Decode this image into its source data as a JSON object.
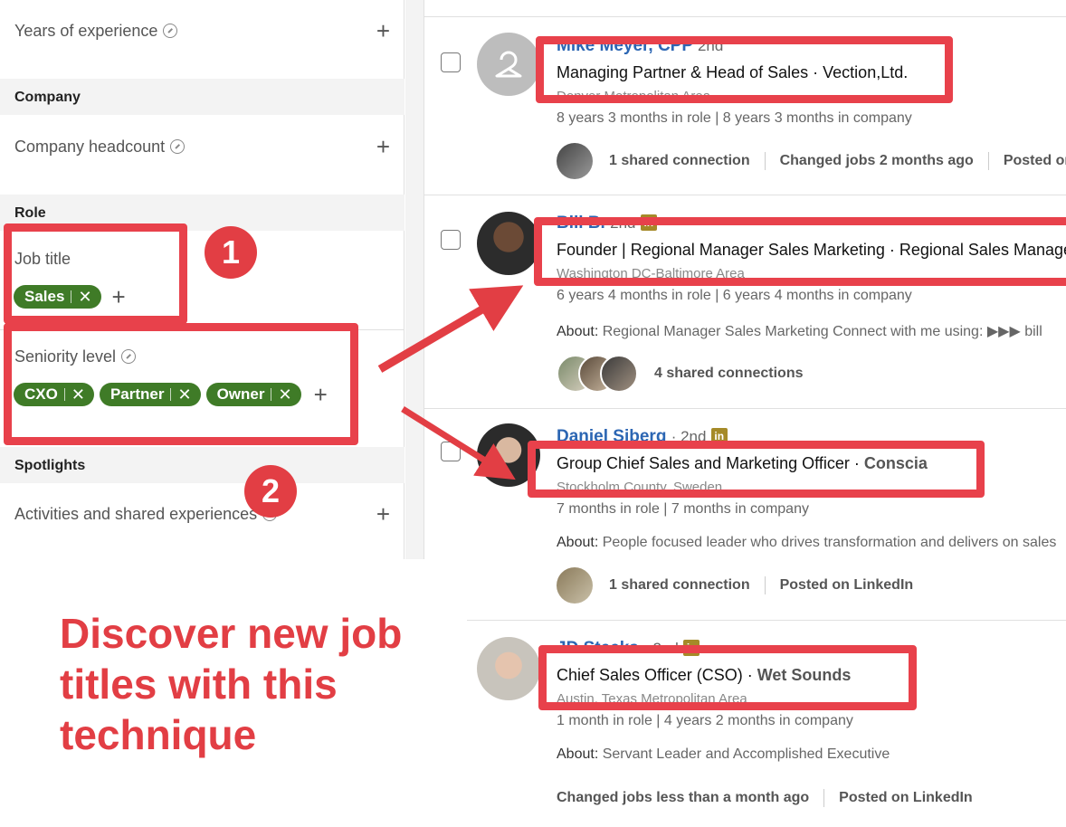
{
  "filters": {
    "years_experience": "Years of experience",
    "company_section": "Company",
    "company_headcount": "Company headcount",
    "role_section": "Role",
    "job_title": "Job title",
    "job_title_chips": [
      "Sales"
    ],
    "seniority_level": "Seniority level",
    "seniority_chips": [
      "CXO",
      "Partner",
      "Owner"
    ],
    "spotlights_section": "Spotlights",
    "activities": "Activities and shared experiences"
  },
  "results": [
    {
      "name": "Mike Meyer, CPP",
      "degree": "2nd",
      "headline_title": "Managing Partner & Head of Sales · Vection,Ltd.",
      "headline_company": "",
      "location": "Denver Metropolitan Area",
      "tenure": "8 years 3 months in role | 8 years 3 months in company",
      "about_label": "",
      "about": "",
      "meta": [
        "1 shared connection",
        "Changed jobs 2 months ago",
        "Posted on LinkedIn"
      ]
    },
    {
      "name": "Bill B.",
      "degree": "2nd",
      "headline_title": "Founder | Regional Manager Sales Marketing · Regional Sales Manager",
      "headline_company": "",
      "location": "Washington DC-Baltimore Area",
      "tenure": "6 years 4 months in role | 6 years 4 months in company",
      "about_label": "About:",
      "about": "Regional Manager Sales Marketing Connect with me using: ▶▶▶ bill",
      "meta": [
        "4 shared connections"
      ]
    },
    {
      "name": "Daniel Siberg",
      "degree": "· 2nd",
      "headline_title": "Group Chief Sales and Marketing Officer · ",
      "headline_company": "Conscia",
      "location": "Stockholm County, Sweden",
      "tenure": "7 months in role | 7 months in company",
      "about_label": "About:",
      "about": "People focused leader who drives transformation and delivers on sales",
      "meta": [
        "1 shared connection",
        "Posted on LinkedIn"
      ]
    },
    {
      "name": "JD Steeks",
      "degree": "· 2nd",
      "headline_title": "Chief Sales Officer (CSO) · ",
      "headline_company": "Wet Sounds",
      "location": "Austin, Texas Metropolitan Area",
      "tenure": "1 month in role | 4 years 2 months in company",
      "about_label": "About:",
      "about": "Servant Leader and Accomplished Executive",
      "meta": [
        "Changed jobs less than a month ago",
        "Posted on LinkedIn"
      ]
    }
  ],
  "annotations": {
    "badge1": "1",
    "badge2": "2",
    "promo": "Discover new job titles with this technique"
  },
  "colors": {
    "accent": "#e8414b",
    "chip": "#3f7b27",
    "link": "#2c66b3"
  }
}
